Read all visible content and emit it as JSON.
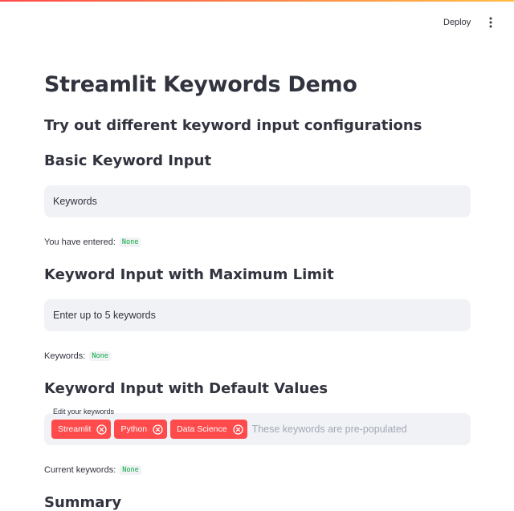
{
  "header": {
    "deploy_label": "Deploy",
    "menu_icon": "vertical-ellipsis-icon"
  },
  "page": {
    "title": "Streamlit Keywords Demo",
    "subtitle": "Try out different keyword input configurations"
  },
  "sections": {
    "basic": {
      "heading": "Basic Keyword Input",
      "placeholder": "Keywords",
      "status_label": "You have entered:",
      "status_value": "None"
    },
    "max_limit": {
      "heading": "Keyword Input with Maximum Limit",
      "placeholder": "Enter up to 5 keywords",
      "status_label": "Keywords:",
      "status_value": "None"
    },
    "defaults": {
      "heading": "Keyword Input with Default Values",
      "field_label": "Edit your keywords",
      "tags": [
        "Streamlit",
        "Python",
        "Data Science"
      ],
      "placeholder": "These keywords are pre-populated",
      "status_label": "Current keywords:",
      "status_value": "None"
    },
    "summary": {
      "heading": "Summary"
    }
  },
  "colors": {
    "accent": "#ff4b4b",
    "input_bg": "#f0f2f6",
    "code_text": "#09ab3b",
    "text": "#31333f",
    "placeholder": "#a3a8b4"
  }
}
